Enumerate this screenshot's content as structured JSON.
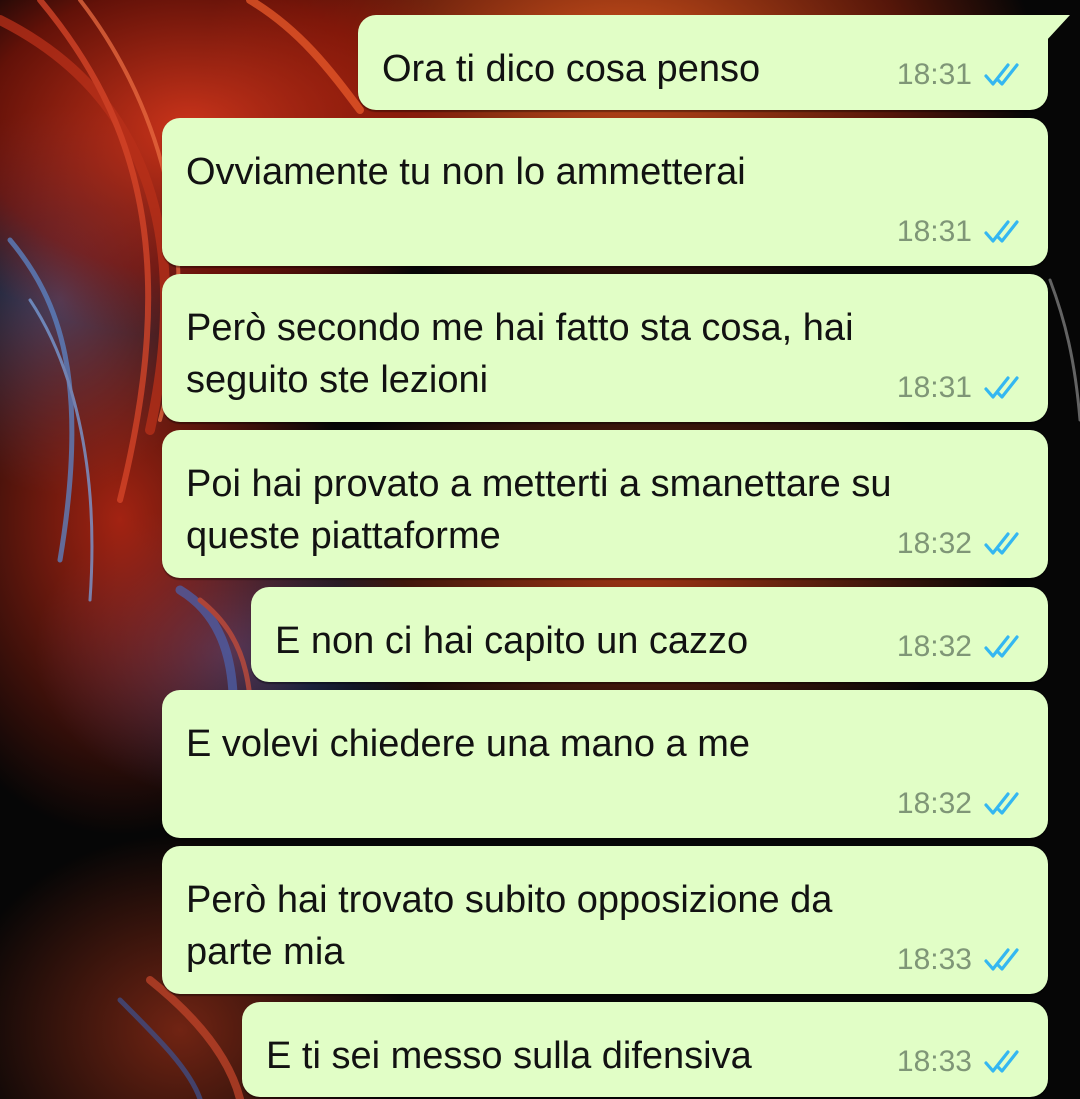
{
  "messages": [
    {
      "text": "Ora ti dico cosa penso",
      "time": "18:31",
      "status": "read"
    },
    {
      "text": "Ovviamente tu non lo ammetterai",
      "time": "18:31",
      "status": "read"
    },
    {
      "text": "Però secondo me hai fatto sta cosa, hai\nseguito ste lezioni",
      "time": "18:31",
      "status": "read"
    },
    {
      "text": "Poi hai provato a metterti a smanettare su\nqueste piattaforme",
      "time": "18:32",
      "status": "read"
    },
    {
      "text": "E non ci hai capito un cazzo",
      "time": "18:32",
      "status": "read"
    },
    {
      "text": "E volevi chiedere una mano a me",
      "time": "18:32",
      "status": "read"
    },
    {
      "text": "Però hai trovato subito opposizione da\nparte mia",
      "time": "18:33",
      "status": "read"
    },
    {
      "text": "E ti sei messo sulla difensiva",
      "time": "18:33",
      "status": "read"
    }
  ],
  "colors": {
    "bubble": "#e1fec6",
    "tick": "#34b7f1",
    "time": "#7f9677"
  },
  "icons": {
    "read_receipt": "double-check-icon"
  }
}
